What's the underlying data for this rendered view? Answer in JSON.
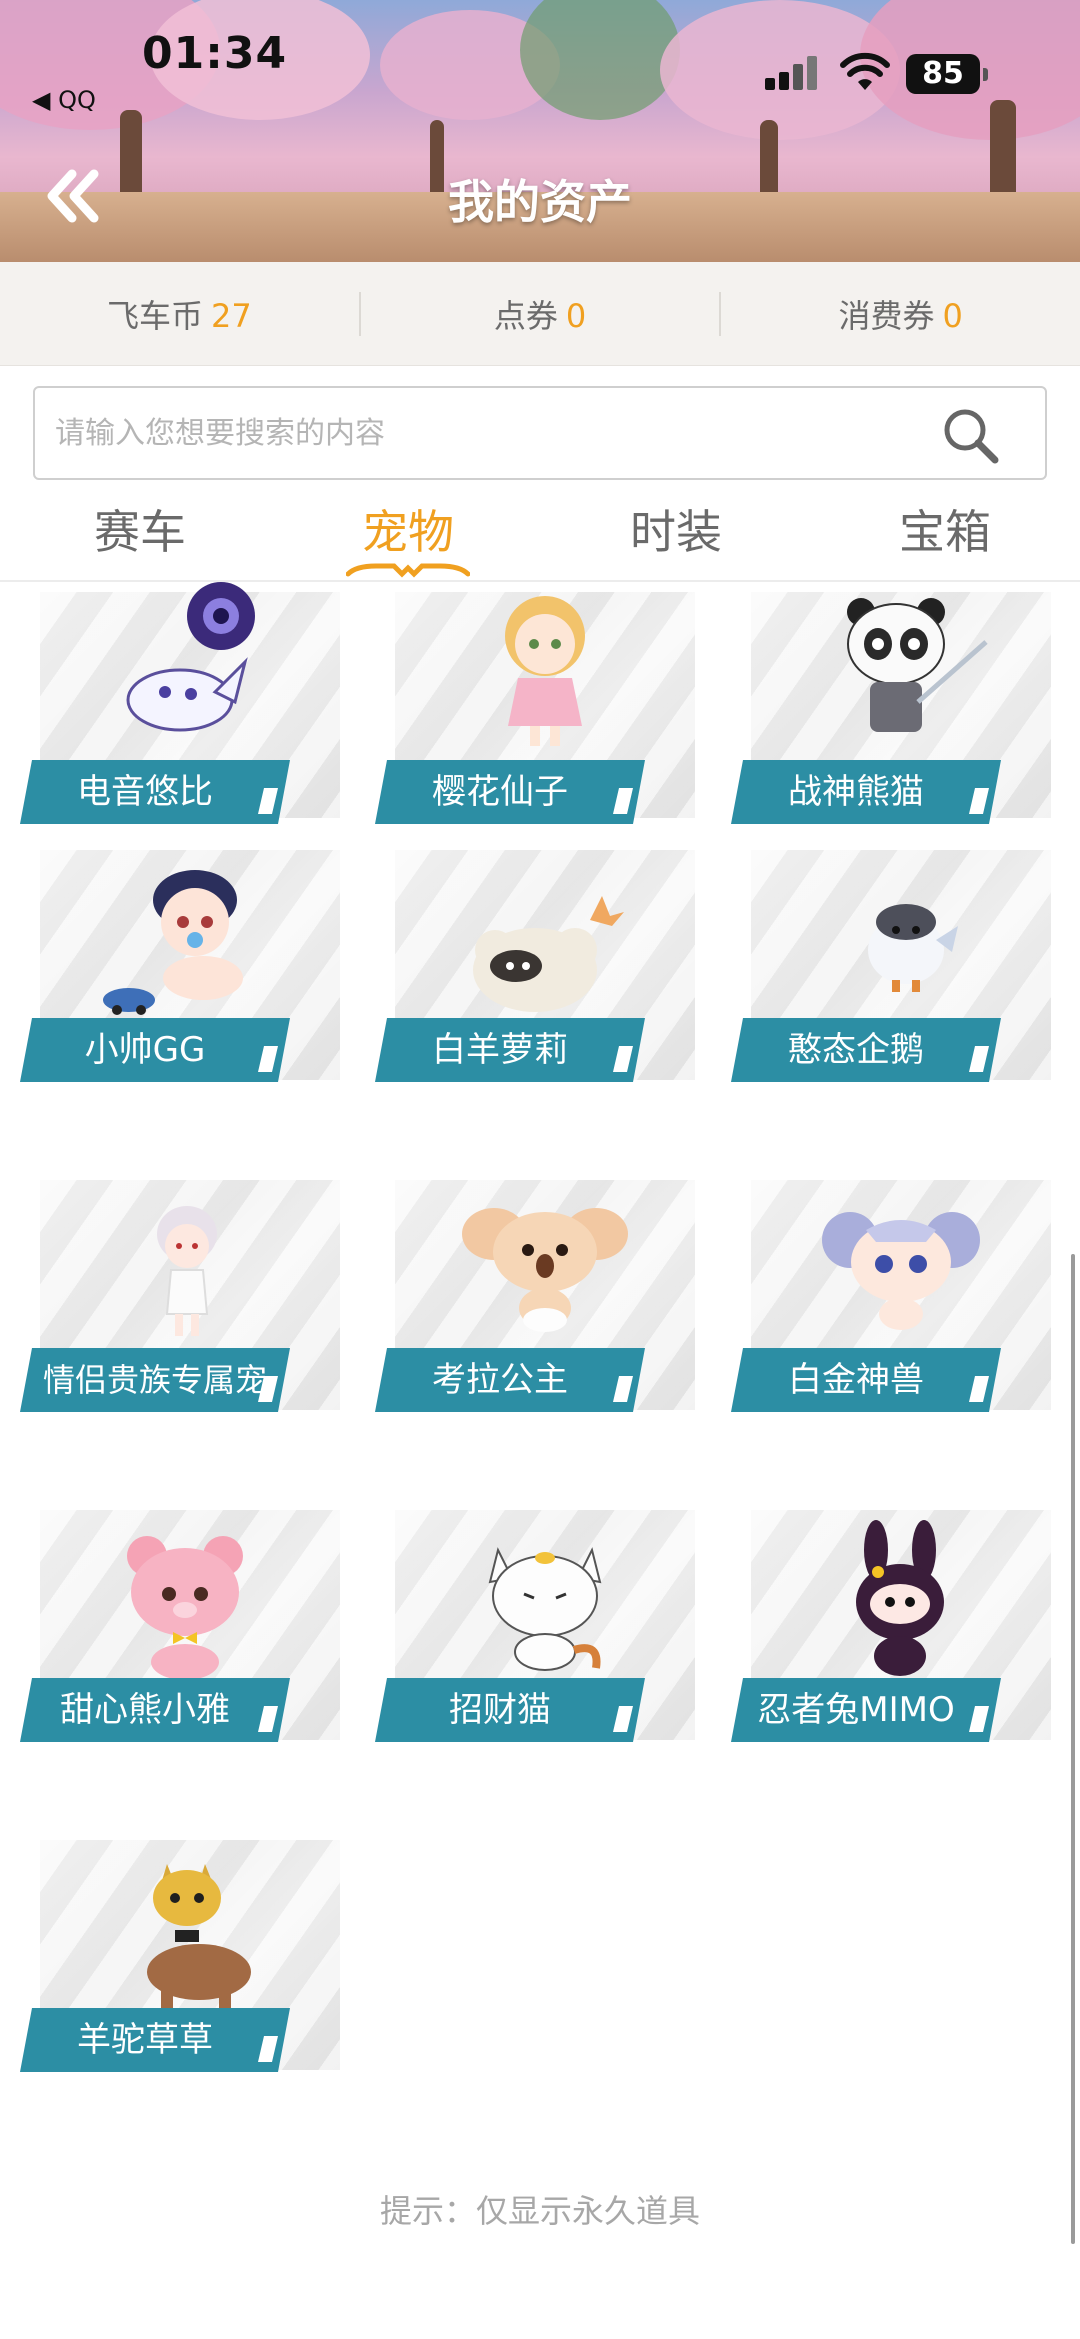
{
  "status_bar": {
    "time": "01:34",
    "back_app": "◀ QQ",
    "battery": "85"
  },
  "header": {
    "title": "我的资产"
  },
  "currency": [
    {
      "label": "飞车币",
      "value": "27"
    },
    {
      "label": "点券",
      "value": "0"
    },
    {
      "label": "消费券",
      "value": "0"
    }
  ],
  "search": {
    "placeholder": "请输入您想要搜索的内容",
    "value": ""
  },
  "tabs": [
    {
      "label": "赛车",
      "active": false
    },
    {
      "label": "宠物",
      "active": true
    },
    {
      "label": "时装",
      "active": false
    },
    {
      "label": "宝箱",
      "active": false
    }
  ],
  "pets": [
    {
      "name": "电音悠比",
      "icon": "purple-orb-pet-icon"
    },
    {
      "name": "樱花仙子",
      "icon": "sakura-fairy-icon"
    },
    {
      "name": "战神熊猫",
      "icon": "panda-warrior-icon"
    },
    {
      "name": "小帅GG",
      "icon": "baby-boy-icon"
    },
    {
      "name": "白羊萝莉",
      "icon": "sheep-icon"
    },
    {
      "name": "憨态企鹅",
      "icon": "penguin-icon"
    },
    {
      "name": "情侣贵族专属宠",
      "icon": "couple-pet-icon"
    },
    {
      "name": "考拉公主",
      "icon": "koala-icon"
    },
    {
      "name": "白金神兽",
      "icon": "mouse-beast-icon"
    },
    {
      "name": "甜心熊小雅",
      "icon": "pink-bear-icon"
    },
    {
      "name": "招财猫",
      "icon": "lucky-cat-icon"
    },
    {
      "name": "忍者兔MIMO",
      "icon": "ninja-rabbit-icon"
    },
    {
      "name": "羊驼草草",
      "icon": "alpaca-icon"
    }
  ],
  "hint": "提示：仅显示永久道具",
  "colors": {
    "accent": "#f0a020",
    "label_bg": "#2c8ea4",
    "currency_bg": "#f4f2ef"
  }
}
